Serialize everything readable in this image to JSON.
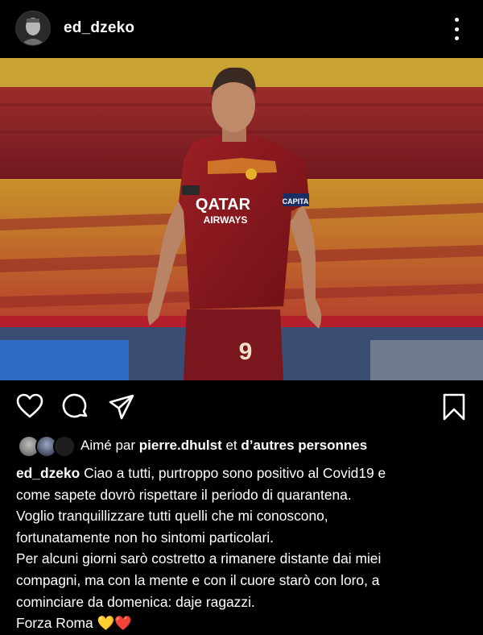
{
  "header": {
    "username": "ed_dzeko"
  },
  "post": {
    "jersey_sponsor_line1": "QATAR",
    "jersey_sponsor_line2": "AIRWAYS",
    "jersey_number": "9",
    "armband_text": "CAPITA"
  },
  "likes": {
    "prefix": "Aimé par",
    "liker": "pierre.dhulst",
    "connector": "et",
    "suffix": "d’autres personnes"
  },
  "caption": {
    "username": "ed_dzeko",
    "lines": [
      "Ciao a tutti, purtroppo sono positivo al Covid19 e",
      "come sapete dovrò rispettare il periodo di quarantena.",
      "Voglio tranquillizzare tutti quelli che mi conoscono,",
      "fortunatamente non ho sintomi particolari.",
      "Per alcuni giorni sarò costretto a rimanere distante dai miei",
      "compagni, ma con la mente e con il cuore starò con loro, a",
      "cominciare da domenica: daje ragazzi.",
      "Forza Roma"
    ],
    "heart_yellow": "💛",
    "heart_red": "❤️"
  },
  "icons": {
    "header": [
      "avatar",
      "more-icon"
    ],
    "actions": [
      "heart-icon",
      "comment-icon",
      "share-icon",
      "bookmark-icon"
    ]
  },
  "colors": {
    "background": "#000000",
    "jersey": "#8b1a1e",
    "stand_yellow": "#d7a52b",
    "stand_red": "#8d1b24"
  }
}
